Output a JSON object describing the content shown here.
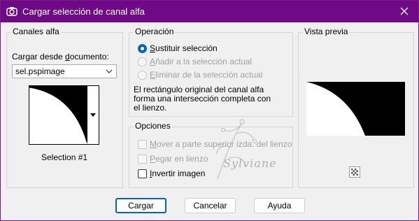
{
  "window": {
    "title": "Cargar selección de canal alfa",
    "title_bar_color": "#6e0a86",
    "icon": "camera-icon",
    "close_icon": "close-icon"
  },
  "channels_group": {
    "legend": "Canales alfa",
    "load_label_before": "Cargar desde ",
    "load_label_mnemonic": "d",
    "load_label_after": "ocumento:",
    "document_value": "sel.pspimage",
    "selection_name": "Selection #1"
  },
  "operation_group": {
    "legend": "Operación",
    "options": [
      {
        "mnemonic": "S",
        "rest": "ustituir selección",
        "selected": true,
        "enabled": true
      },
      {
        "mnemonic": "A",
        "rest": "ñadir a la selección actual",
        "selected": false,
        "enabled": false
      },
      {
        "mnemonic": "E",
        "rest": "liminar de la selección actual",
        "selected": false,
        "enabled": false
      }
    ],
    "info_lines": [
      "El rectángulo original del canal alfa",
      "forma una intersección completa con",
      "el lienzo."
    ]
  },
  "options_group": {
    "legend": "Opciones",
    "checkboxes": [
      {
        "mnemonic": "M",
        "rest": "over a parte superior izda. del lienzo",
        "checked": false,
        "enabled": false
      },
      {
        "mnemonic": "P",
        "rest": "egar en lienzo",
        "checked": false,
        "enabled": false
      },
      {
        "mnemonic": "I",
        "rest": "nvertir imagen",
        "checked": false,
        "enabled": true
      }
    ]
  },
  "preview_group": {
    "legend": "Vista previa",
    "zoom_icon": "checkerboard-zoom-icon"
  },
  "watermark_text": "Sylviane",
  "buttons": {
    "load": "Cargar",
    "cancel": "Cancelar",
    "help": "Ayuda"
  },
  "colors": {
    "accent": "#0067c0",
    "dialog_bg": "#f0f0f0"
  }
}
